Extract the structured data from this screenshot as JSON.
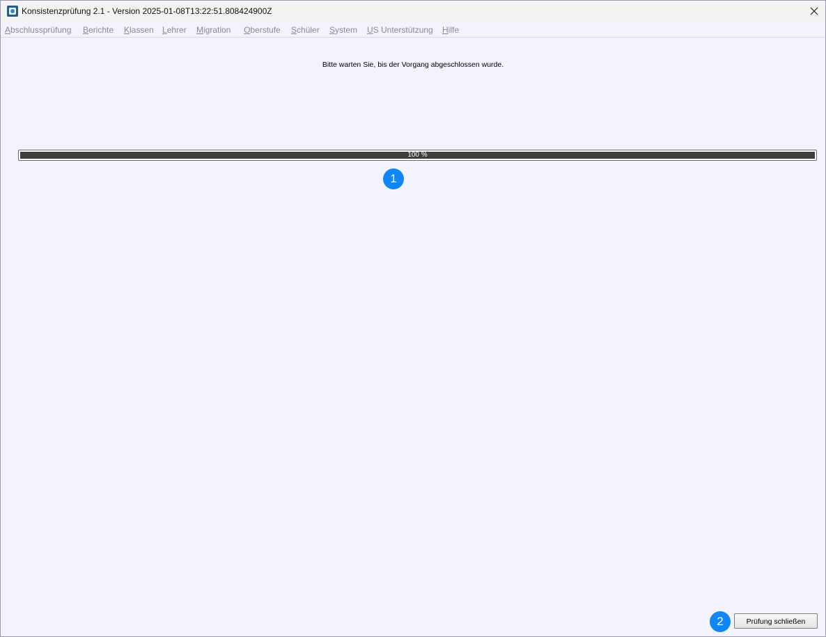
{
  "window": {
    "title": "Konsistenzprüfung 2.1 - Version 2025-01-08T13:22:51.808424900Z",
    "app_icon": "app-logo-icon",
    "close_icon": "close-icon"
  },
  "menu": [
    {
      "mnemonic": "A",
      "rest": "bschlussprüfung"
    },
    {
      "mnemonic": "B",
      "rest": "erichte"
    },
    {
      "mnemonic": "K",
      "rest": "lassen"
    },
    {
      "mnemonic": "L",
      "rest": "ehrer"
    },
    {
      "mnemonic": "M",
      "rest": "igration"
    },
    {
      "mnemonic": "O",
      "rest": "berstufe"
    },
    {
      "mnemonic": "S",
      "rest": "chüler"
    },
    {
      "mnemonic": "S",
      "rest": "ystem"
    },
    {
      "mnemonic": "U",
      "rest": "S Unterstützung"
    },
    {
      "mnemonic": "H",
      "rest": "ilfe"
    }
  ],
  "main": {
    "status_message": "Bitte warten Sie, bis der Vorgang abgeschlossen wurde.",
    "progress": {
      "value": 100,
      "label": "100 %"
    }
  },
  "annotations": {
    "badge_1": "1",
    "badge_2": "2"
  },
  "footer": {
    "close_check_label": "Prüfung schließen"
  },
  "colors": {
    "background": "#f3f3fe",
    "progress_fill": "#3e3e3e",
    "badge": "#1187f5",
    "menu_text": "#8a8a92"
  }
}
